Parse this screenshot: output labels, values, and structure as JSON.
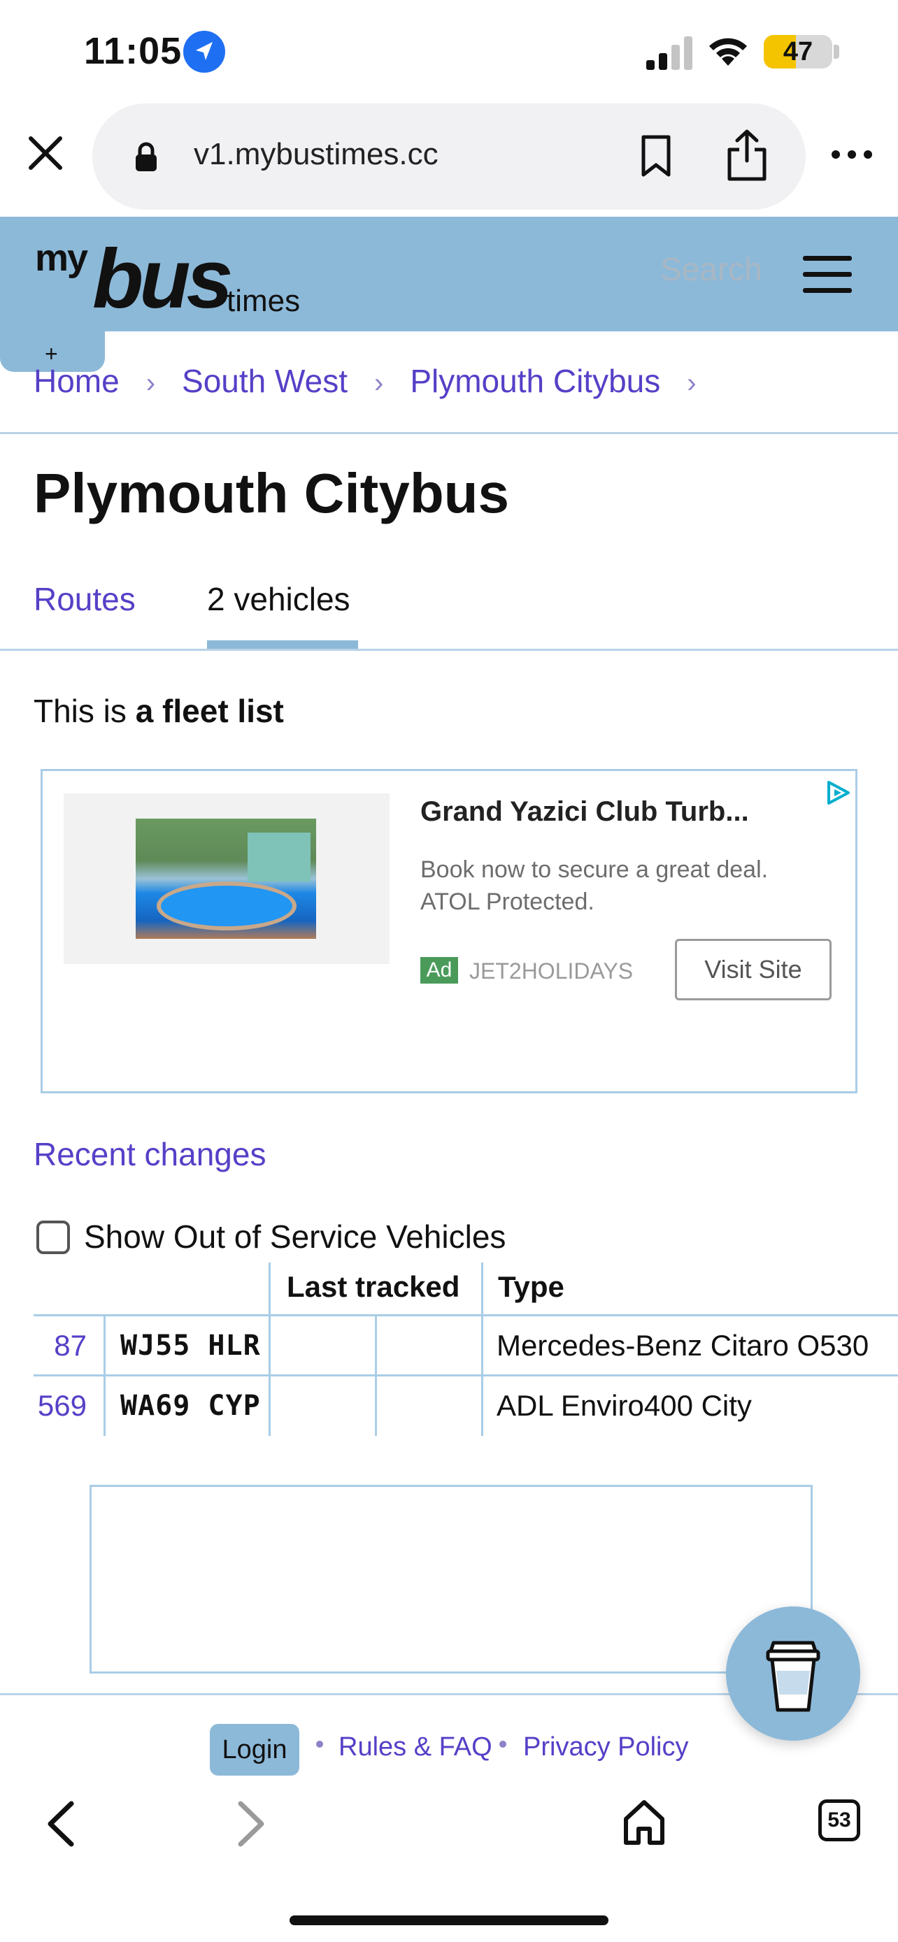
{
  "status_bar": {
    "time": "11:05",
    "battery": "47",
    "battery_level": 0.47,
    "battery_color": "#f5c400"
  },
  "browser": {
    "url": "v1.mybustimes.cc",
    "tab_count": "53"
  },
  "site": {
    "logo": {
      "my": "my",
      "bus": "bus",
      "times": "times"
    },
    "search_placeholder": "Search",
    "plus": "+",
    "header_color": "#8db9d9",
    "link_color": "#5540c7"
  },
  "breadcrumb": {
    "items": [
      "Home",
      "South West",
      "Plymouth Citybus"
    ],
    "separator": "›"
  },
  "page": {
    "title": "Plymouth Citybus",
    "tabs": [
      {
        "label": "Routes",
        "active": false
      },
      {
        "label": "2 vehicles",
        "active": true
      }
    ],
    "intro_prefix": "This is ",
    "intro_bold": "a fleet list",
    "recent_changes": "Recent changes"
  },
  "ad": {
    "title": "Grand Yazici Club Turb...",
    "description": "Book now to secure a great deal. ATOL Protected.",
    "badge": "Ad",
    "advertiser": "JET2HOLIDAYS",
    "button": "Visit Site"
  },
  "filter": {
    "checkbox_label": "Show Out of Service Vehicles",
    "checked": false
  },
  "table": {
    "headers": [
      "",
      "",
      "Last tracked",
      "",
      "Type"
    ],
    "rows": [
      {
        "fleet": "87",
        "reg": "WJ55 HLR",
        "last_tracked": "",
        "extra": "",
        "type": "Mercedes-Benz Citaro O530"
      },
      {
        "fleet": "569",
        "reg": "WA69 CYP",
        "last_tracked": "",
        "extra": "",
        "type": "ADL Enviro400 City"
      }
    ]
  },
  "footer": {
    "login": "Login",
    "links": [
      "Rules & FAQ",
      "Privacy Policy"
    ]
  }
}
